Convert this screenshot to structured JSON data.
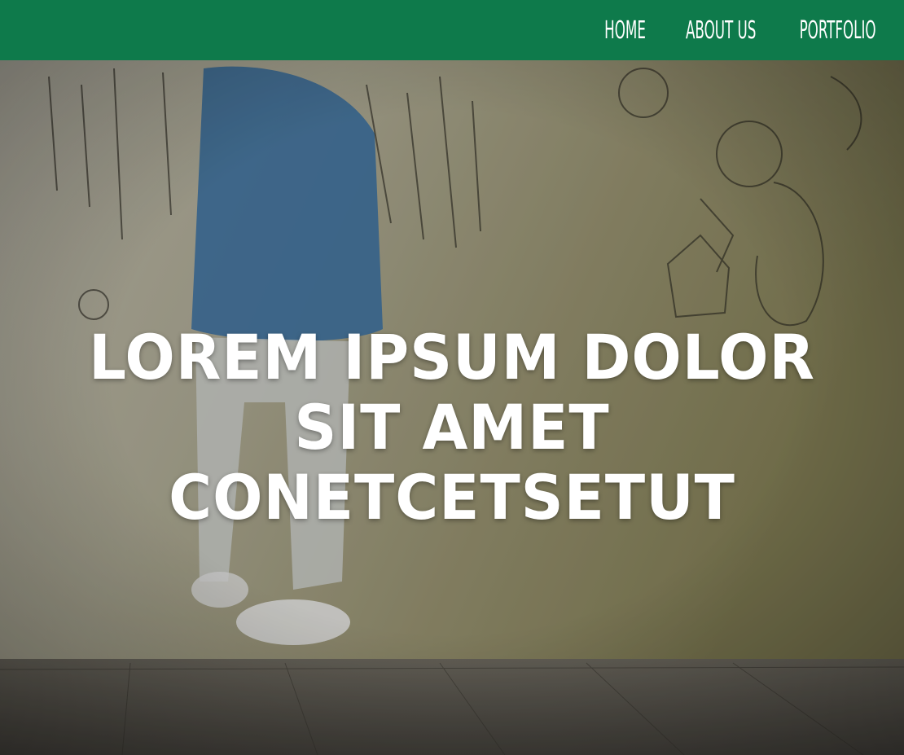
{
  "nav": {
    "items": [
      {
        "label": "HOME"
      },
      {
        "label": "ABOUT US"
      },
      {
        "label": "PORTFOLIO"
      }
    ],
    "background": "#0e7a4b",
    "text_color": "#ffffff"
  },
  "hero": {
    "title": "Lorem ipsum dolor sit amet conetcetsetut",
    "image": "graffiti-child-wall-photo",
    "text_color": "#ffffff"
  }
}
